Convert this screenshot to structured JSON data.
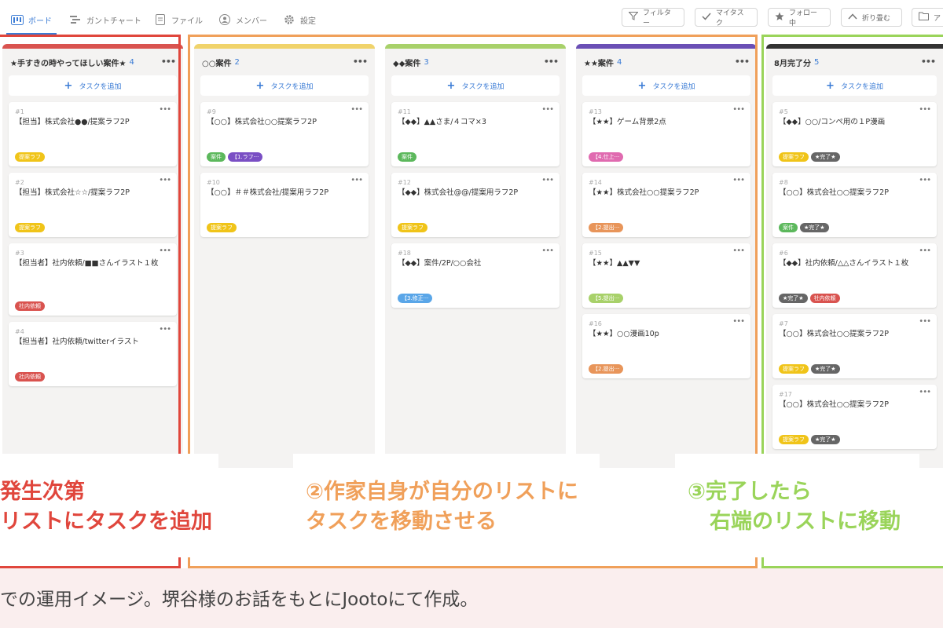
{
  "nav": {
    "tabs": [
      {
        "label": "ボード",
        "icon": "board-icon"
      },
      {
        "label": "ガントチャート",
        "icon": "gantt-icon"
      },
      {
        "label": "ファイル",
        "icon": "file-icon"
      },
      {
        "label": "メンバー",
        "icon": "member-icon"
      },
      {
        "label": "設定",
        "icon": "gear-icon"
      }
    ],
    "tools": [
      {
        "label": "フィルター",
        "icon": "filter-icon"
      },
      {
        "label": "マイタスク",
        "icon": "check-icon"
      },
      {
        "label": "フォロー中",
        "icon": "star-icon"
      },
      {
        "label": "折り畳む",
        "icon": "chevron-up-icon"
      },
      {
        "label": "ア",
        "icon": "folder-icon"
      }
    ]
  },
  "add_task_label": "タスクを追加",
  "columns": [
    {
      "title": "★手すきの時やってほしい案件★",
      "count": "4",
      "color": "#d9534f",
      "cards": [
        {
          "num": "#1",
          "title": "【担当】株式会社●●/提案ラフ2P",
          "tags": [
            {
              "label": "提案ラフ",
              "color": "#f0c419"
            }
          ]
        },
        {
          "num": "#2",
          "title": "【担当】株式会社☆☆/提案ラフ2P",
          "tags": [
            {
              "label": "提案ラフ",
              "color": "#f0c419"
            }
          ]
        },
        {
          "num": "#3",
          "title": "【担当者】社内依頼/■■さんイラスト１枚",
          "tags": [
            {
              "label": "社内依頼",
              "color": "#d9534f"
            }
          ]
        },
        {
          "num": "#4",
          "title": "【担当者】社内依頼/twitterイラスト",
          "tags": [
            {
              "label": "社内依頼",
              "color": "#d9534f"
            }
          ]
        }
      ]
    },
    {
      "title": "○○案件",
      "count": "2",
      "color": "#f0d36b",
      "cards": [
        {
          "num": "#9",
          "title": "【○○】株式会社○○提案ラフ2P",
          "tags": [
            {
              "label": "案件",
              "color": "#5cb85c"
            },
            {
              "label": "【1.ラフ···",
              "color": "#7a4fc4"
            }
          ]
        },
        {
          "num": "#10",
          "title": "【○○】＃＃株式会社/提案用ラフ2P",
          "tags": [
            {
              "label": "提案ラフ",
              "color": "#f0c419"
            }
          ]
        }
      ]
    },
    {
      "title": "◆◆案件",
      "count": "3",
      "color": "#a8d16a",
      "cards": [
        {
          "num": "#11",
          "title": "【◆◆】▲▲さま/４コマ×3",
          "tags": [
            {
              "label": "案件",
              "color": "#5cb85c"
            }
          ]
        },
        {
          "num": "#12",
          "title": "【◆◆】株式会社@@/提案用ラフ2P",
          "tags": [
            {
              "label": "提案ラフ",
              "color": "#f0c419"
            }
          ]
        },
        {
          "num": "#18",
          "title": "【◆◆】案件/2P/○○会社",
          "tags": [
            {
              "label": "【3.修正···",
              "color": "#5aa6e8"
            }
          ]
        }
      ]
    },
    {
      "title": "★★案件",
      "count": "4",
      "color": "#6a4fb5",
      "cards": [
        {
          "num": "#13",
          "title": "【★★】ゲーム背景2点",
          "tags": [
            {
              "label": "【4.仕上···",
              "color": "#e06bb0"
            }
          ]
        },
        {
          "num": "#14",
          "title": "【★★】株式会社○○提案ラフ2P",
          "tags": [
            {
              "label": "【2.提出···",
              "color": "#e8955a"
            }
          ]
        },
        {
          "num": "#15",
          "title": "【★★】▲▲▼▼",
          "tags": [
            {
              "label": "【5.提出···",
              "color": "#a8d16a"
            }
          ]
        },
        {
          "num": "#16",
          "title": "【★★】○○漫画10p",
          "tags": [
            {
              "label": "【2.提出···",
              "color": "#e8955a"
            }
          ]
        }
      ]
    },
    {
      "title": "8月完了分",
      "count": "5",
      "color": "#333333",
      "cards": [
        {
          "num": "#5",
          "title": "【◆◆】○○/コンペ用の１P漫画",
          "tags": [
            {
              "label": "提案ラフ",
              "color": "#f0c419"
            },
            {
              "label": "★完了★",
              "color": "#666666"
            }
          ]
        },
        {
          "num": "#8",
          "title": "【○○】株式会社○○提案ラフ2P",
          "tags": [
            {
              "label": "案件",
              "color": "#5cb85c"
            },
            {
              "label": "★完了★",
              "color": "#666666"
            }
          ]
        },
        {
          "num": "#6",
          "title": "【◆◆】社内依頼/△△さんイラスト１枚",
          "tags": [
            {
              "label": "★完了★",
              "color": "#666666"
            },
            {
              "label": "社内依頼",
              "color": "#d9534f"
            }
          ]
        },
        {
          "num": "#7",
          "title": "【○○】株式会社○○提案ラフ2P",
          "tags": [
            {
              "label": "提案ラフ",
              "color": "#f0c419"
            },
            {
              "label": "★完了★",
              "color": "#666666"
            }
          ]
        },
        {
          "num": "#17",
          "title": "【○○】株式会社○○提案ラフ2P",
          "tags": [
            {
              "label": "提案ラフ",
              "color": "#f0c419"
            },
            {
              "label": "★完了★",
              "color": "#666666"
            }
          ]
        }
      ]
    }
  ],
  "annotations": [
    {
      "color": "#e0463c",
      "lines": [
        "発生次第",
        "リストにタスクを追加"
      ]
    },
    {
      "color": "#f0a05a",
      "lines": [
        "②作家自身が自分のリストに",
        "タスクを移動させる"
      ]
    },
    {
      "color": "#9ad45a",
      "lines": [
        "③完了したら",
        "右端のリストに移動"
      ]
    }
  ],
  "caption": "での運用イメージ。堺谷様のお話をもとにJootoにて作成。"
}
